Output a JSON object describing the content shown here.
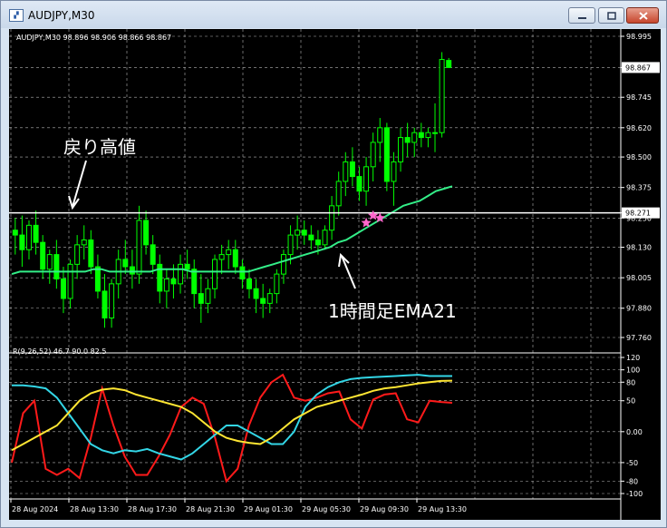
{
  "window": {
    "title": "AUDJPY,M30",
    "icon_name": "chart-window-icon",
    "buttons": [
      "minimize-icon",
      "maximize-icon",
      "close-icon"
    ]
  },
  "colors": {
    "background": "#000000",
    "grid": "#b4b4b4",
    "text": "#ffffff",
    "bull_candle": "#00ff00",
    "bear_candle": "#00ff00",
    "ema": "#33ee88",
    "line_level": "#ffffff",
    "rci_short": "#ff1a1a",
    "rci_mid": "#33d6e6",
    "rci_long": "#ffe633",
    "marker": "#ff66cc"
  },
  "chart_data": [
    {
      "type": "candlestick",
      "title": "AUDJPY,M30",
      "ohlc_header": "AUDJPY,M30  98.896 98.906 98.866 98.867",
      "ylim": [
        97.76,
        98.995
      ],
      "y_ticks": [
        "98.995",
        "98.867",
        "98.745",
        "98.620",
        "98.500",
        "98.375",
        "98.271",
        "98.250",
        "98.130",
        "98.005",
        "97.880",
        "97.760"
      ],
      "current_price_label": "98.867",
      "level_label": "98.271",
      "x_tick_labels": [
        "28 Aug 2024",
        "28 Aug 13:30",
        "28 Aug 17:30",
        "28 Aug 21:30",
        "29 Aug 01:30",
        "29 Aug 05:30",
        "29 Aug 09:30",
        "29 Aug 13:30"
      ],
      "annotations": [
        "戻り高値",
        "1時間足EMA21"
      ],
      "candles": [
        [
          98.2,
          98.25,
          98.1,
          98.18
        ],
        [
          98.18,
          98.26,
          98.05,
          98.12
        ],
        [
          98.12,
          98.24,
          98.08,
          98.22
        ],
        [
          98.22,
          98.28,
          98.1,
          98.15
        ],
        [
          98.15,
          98.18,
          98.0,
          98.04
        ],
        [
          98.04,
          98.12,
          97.98,
          98.1
        ],
        [
          98.1,
          98.16,
          97.96,
          98.0
        ],
        [
          98.0,
          98.05,
          97.86,
          97.92
        ],
        [
          97.92,
          98.08,
          97.88,
          98.06
        ],
        [
          98.06,
          98.18,
          98.0,
          98.14
        ],
        [
          98.14,
          98.22,
          98.08,
          98.16
        ],
        [
          98.16,
          98.2,
          98.02,
          98.05
        ],
        [
          98.05,
          98.1,
          97.92,
          97.95
        ],
        [
          97.95,
          98.02,
          97.8,
          97.84
        ],
        [
          97.84,
          98.0,
          97.8,
          97.98
        ],
        [
          97.98,
          98.12,
          97.92,
          98.08
        ],
        [
          98.08,
          98.16,
          98.02,
          98.05
        ],
        [
          98.05,
          98.12,
          97.96,
          98.02
        ],
        [
          98.02,
          98.3,
          97.98,
          98.24
        ],
        [
          98.24,
          98.28,
          98.1,
          98.14
        ],
        [
          98.14,
          98.18,
          98.02,
          98.06
        ],
        [
          98.06,
          98.1,
          97.9,
          97.95
        ],
        [
          97.95,
          98.04,
          97.88,
          98.0
        ],
        [
          98.0,
          98.06,
          97.92,
          97.98
        ],
        [
          97.98,
          98.1,
          97.94,
          98.06
        ],
        [
          98.06,
          98.12,
          98.0,
          98.04
        ],
        [
          98.04,
          98.08,
          97.88,
          97.94
        ],
        [
          97.94,
          98.02,
          97.82,
          97.9
        ],
        [
          97.9,
          98.0,
          97.86,
          97.96
        ],
        [
          97.96,
          98.1,
          97.92,
          98.08
        ],
        [
          98.08,
          98.14,
          98.02,
          98.1
        ],
        [
          98.1,
          98.16,
          98.04,
          98.12
        ],
        [
          98.12,
          98.16,
          98.02,
          98.05
        ],
        [
          98.05,
          98.08,
          97.96,
          98.0
        ],
        [
          98.0,
          98.04,
          97.92,
          97.96
        ],
        [
          97.96,
          98.0,
          97.86,
          97.92
        ],
        [
          97.92,
          97.98,
          97.84,
          97.9
        ],
        [
          97.9,
          97.96,
          97.86,
          97.94
        ],
        [
          97.94,
          98.04,
          97.9,
          98.02
        ],
        [
          98.02,
          98.12,
          97.98,
          98.1
        ],
        [
          98.1,
          98.22,
          98.06,
          98.18
        ],
        [
          98.18,
          98.26,
          98.12,
          98.2
        ],
        [
          98.2,
          98.24,
          98.14,
          98.18
        ],
        [
          98.18,
          98.22,
          98.12,
          98.16
        ],
        [
          98.16,
          98.2,
          98.1,
          98.14
        ],
        [
          98.14,
          98.22,
          98.12,
          98.2
        ],
        [
          98.2,
          98.34,
          98.16,
          98.3
        ],
        [
          98.3,
          98.44,
          98.26,
          98.4
        ],
        [
          98.4,
          98.52,
          98.34,
          98.48
        ],
        [
          98.48,
          98.54,
          98.38,
          98.42
        ],
        [
          98.42,
          98.46,
          98.32,
          98.36
        ],
        [
          98.36,
          98.5,
          98.3,
          98.46
        ],
        [
          98.46,
          98.6,
          98.4,
          98.56
        ],
        [
          98.56,
          98.66,
          98.48,
          98.62
        ],
        [
          98.62,
          98.64,
          98.36,
          98.4
        ],
        [
          98.4,
          98.52,
          98.3,
          98.48
        ],
        [
          98.48,
          98.62,
          98.44,
          98.58
        ],
        [
          98.58,
          98.64,
          98.5,
          98.56
        ],
        [
          98.56,
          98.62,
          98.5,
          98.6
        ],
        [
          98.6,
          98.64,
          98.54,
          98.58
        ],
        [
          98.58,
          98.62,
          98.54,
          98.6
        ],
        [
          98.6,
          98.72,
          98.52,
          98.6
        ],
        [
          98.6,
          98.93,
          98.58,
          98.9
        ],
        [
          98.896,
          98.906,
          98.866,
          98.867
        ]
      ],
      "ema21": [
        98.02,
        98.03,
        98.03,
        98.03,
        98.03,
        98.03,
        98.03,
        98.03,
        98.03,
        98.03,
        98.04,
        98.04,
        98.03,
        98.03,
        98.03,
        98.03,
        98.03,
        98.03,
        98.04,
        98.04,
        98.04,
        98.04,
        98.03,
        98.03,
        98.03,
        98.03,
        98.03,
        98.03,
        98.03,
        98.03,
        98.04,
        98.05,
        98.06,
        98.07,
        98.08,
        98.09,
        98.1,
        98.11,
        98.12,
        98.13,
        98.15,
        98.16,
        98.18,
        98.2,
        98.22,
        98.24,
        98.26,
        98.28,
        98.3,
        98.31,
        98.32,
        98.34,
        98.36,
        98.37,
        98.38
      ],
      "level_price": 98.271,
      "markers": [
        [
          51,
          98.23
        ],
        [
          52,
          98.26
        ],
        [
          53,
          98.25
        ]
      ]
    },
    {
      "type": "line",
      "title": "R(9,26,52) 46.7 90.0 82.5",
      "ylim": [
        -100,
        120
      ],
      "y_ticks": [
        "120",
        "100",
        "80",
        "50",
        "0.00",
        "-50",
        "-80",
        "-100"
      ],
      "series": [
        {
          "name": "9",
          "color": "#ff1a1a",
          "values": [
            -50,
            30,
            50,
            -60,
            -70,
            -60,
            -75,
            -10,
            70,
            10,
            -40,
            -70,
            -70,
            -40,
            -5,
            40,
            55,
            45,
            -10,
            -80,
            -60,
            10,
            55,
            80,
            92,
            55,
            50,
            55,
            62,
            65,
            20,
            5,
            52,
            60,
            62,
            20,
            15,
            50,
            48,
            46.7
          ]
        },
        {
          "name": "26",
          "color": "#33d6e6",
          "values": [
            75,
            75,
            73,
            70,
            55,
            30,
            5,
            -20,
            -30,
            -35,
            -30,
            -32,
            -28,
            -35,
            -40,
            -45,
            -35,
            -20,
            -5,
            10,
            10,
            0,
            -10,
            -20,
            -20,
            0,
            40,
            60,
            72,
            80,
            85,
            87,
            88,
            89,
            90,
            91,
            92,
            90,
            90,
            90.0
          ]
        },
        {
          "name": "52",
          "color": "#ffe633",
          "values": [
            -30,
            -20,
            -10,
            0,
            10,
            30,
            50,
            62,
            68,
            70,
            67,
            60,
            55,
            50,
            45,
            40,
            30,
            15,
            0,
            -10,
            -15,
            -18,
            -20,
            -10,
            5,
            20,
            30,
            40,
            45,
            50,
            55,
            60,
            66,
            70,
            72,
            75,
            78,
            80,
            82,
            82.5
          ]
        }
      ]
    }
  ]
}
